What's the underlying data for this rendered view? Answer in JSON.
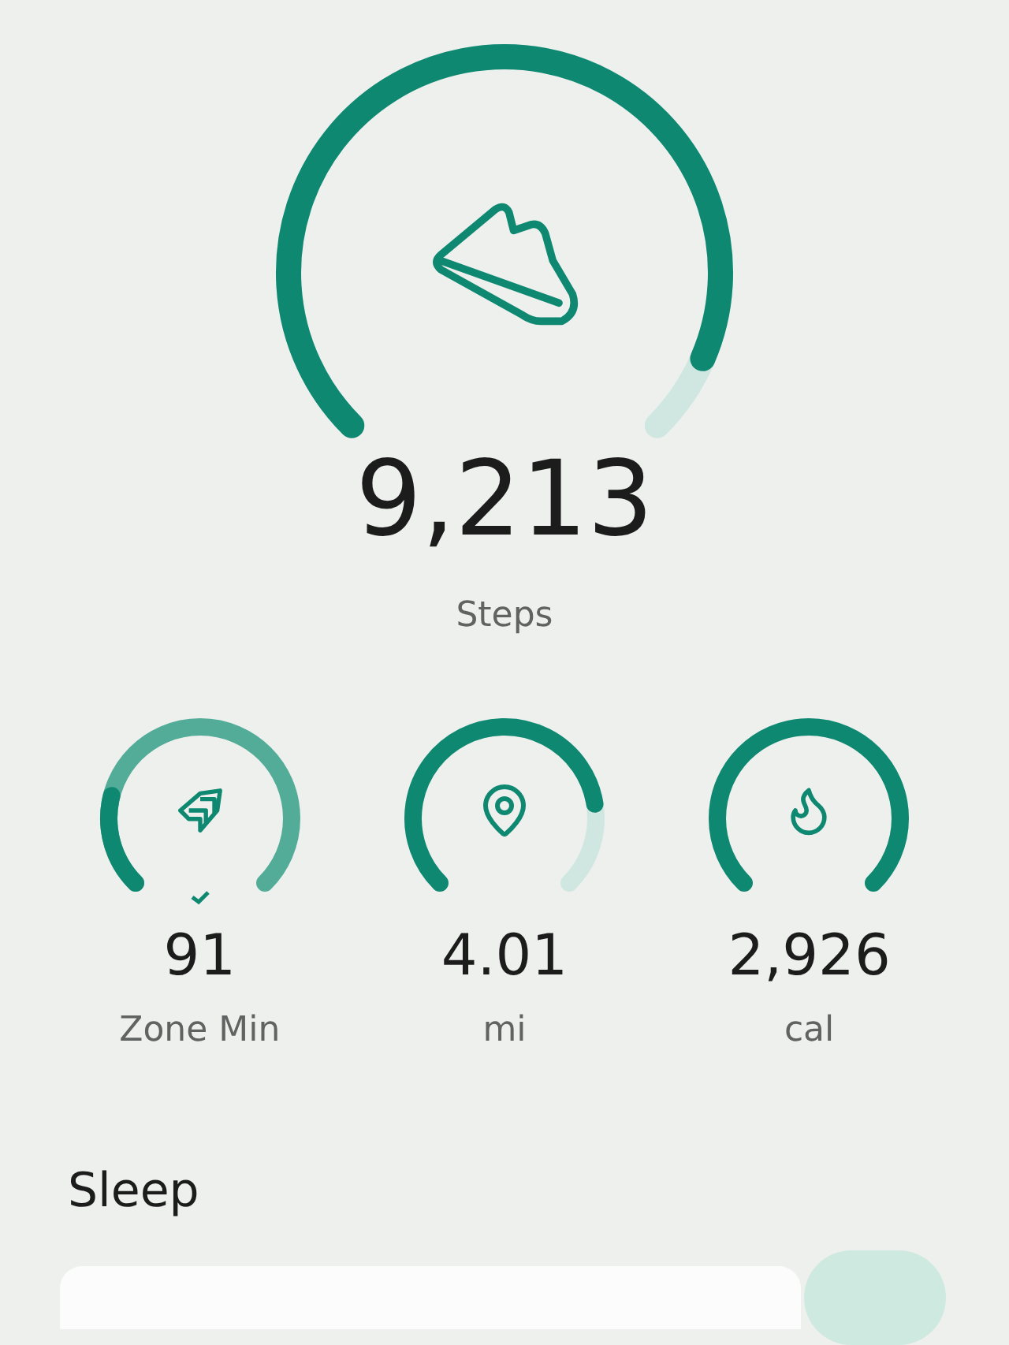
{
  "steps": {
    "value": "9,213",
    "label": "Steps"
  },
  "metrics": [
    {
      "kind": "exceeded",
      "value": "91",
      "label": "Zone Min"
    },
    {
      "kind": "progress",
      "value": "4.01",
      "label": "mi"
    },
    {
      "kind": "complete",
      "value": "2,926",
      "label": "cal"
    }
  ],
  "sleep": {
    "title": "Sleep"
  }
}
